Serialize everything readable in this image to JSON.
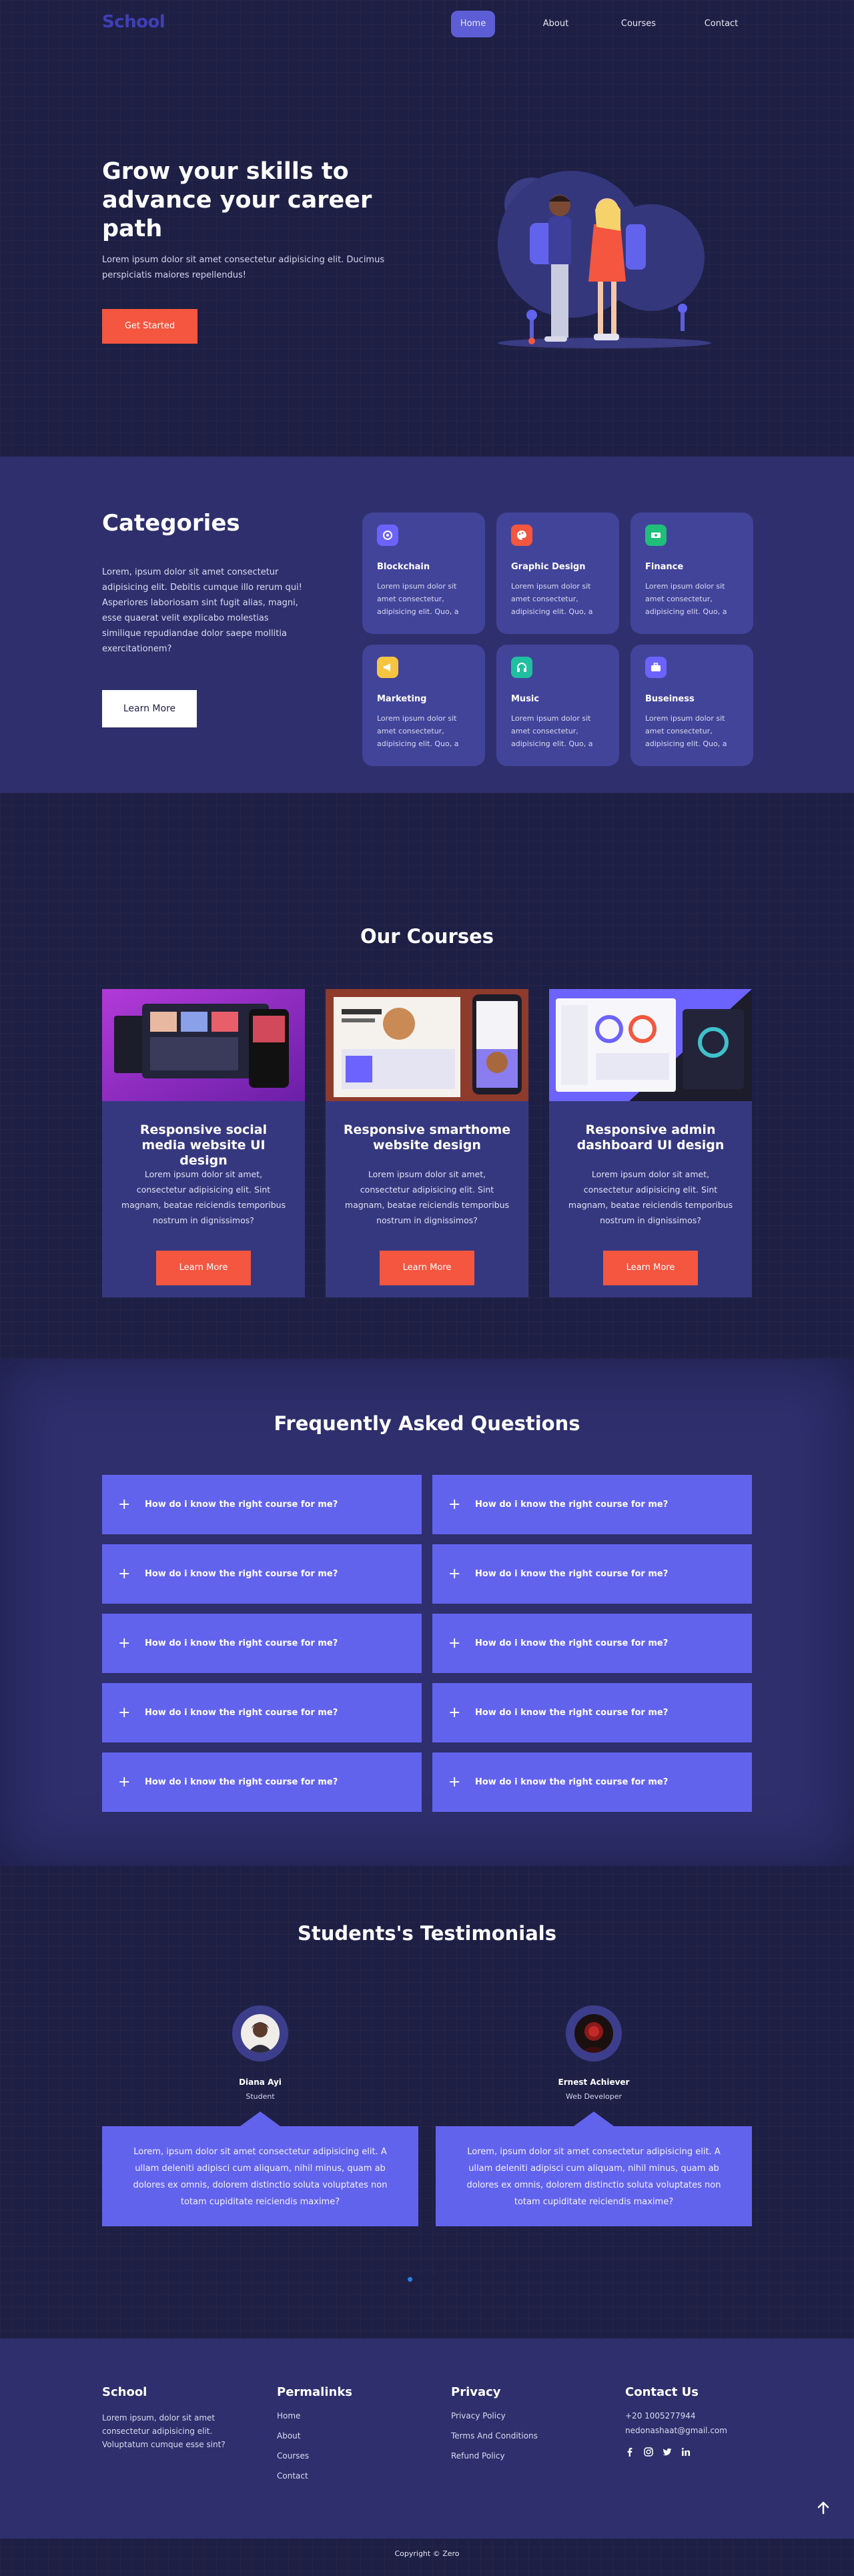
{
  "nav": {
    "logo": "School",
    "links": [
      {
        "label": "Home",
        "active": true
      },
      {
        "label": "About",
        "active": false
      },
      {
        "label": "Courses",
        "active": false
      },
      {
        "label": "Contact",
        "active": false
      }
    ]
  },
  "hero": {
    "title": "Grow your skills to advance your career path",
    "text": "Lorem ipsum dolor sit amet consectetur adipisicing elit. Ducimus perspiciatis maiores repellendus!",
    "button": "Get Started"
  },
  "categories": {
    "title": "Categories",
    "text": "Lorem, ipsum dolor sit amet consectetur adipisicing elit. Debitis cumque illo rerum qui! Asperiores laboriosam sint fugit alias, magni, esse quaerat velit explicabo molestias similique repudiandae dolor saepe mollitia exercitationem?",
    "button": "Learn More",
    "items": [
      {
        "name": "Blockchain",
        "icon": "blockchain-icon",
        "color": "#6c63ff",
        "desc": "Lorem ipsum dolor sit amet consectetur, adipisicing elit. Quo, a"
      },
      {
        "name": "Graphic Design",
        "icon": "palette-icon",
        "color": "#f4563f",
        "desc": "Lorem ipsum dolor sit amet consectetur, adipisicing elit. Quo, a"
      },
      {
        "name": "Finance",
        "icon": "money-icon",
        "color": "#1fbf7a",
        "desc": "Lorem ipsum dolor sit amet consectetur, adipisicing elit. Quo, a"
      },
      {
        "name": "Marketing",
        "icon": "megaphone-icon",
        "color": "#f5c542",
        "desc": "Lorem ipsum dolor sit amet consectetur, adipisicing elit. Quo, a"
      },
      {
        "name": "Music",
        "icon": "headphones-icon",
        "color": "#1fbf9f",
        "desc": "Lorem ipsum dolor sit amet consectetur, adipisicing elit. Quo, a"
      },
      {
        "name": "Buseiness",
        "icon": "briefcase-icon",
        "color": "#6c63ff",
        "desc": "Lorem ipsum dolor sit amet consectetur, adipisicing elit. Quo, a"
      }
    ]
  },
  "courses": {
    "title": "Our Courses",
    "items": [
      {
        "name": "Responsive social media website UI design",
        "desc": "Lorem ipsum dolor sit amet, consectetur adipisicing elit. Sint magnam, beatae reiciendis temporibus nostrum in dignissimos?",
        "button": "Learn More"
      },
      {
        "name": "Responsive smarthome website design",
        "desc": "Lorem ipsum dolor sit amet, consectetur adipisicing elit. Sint magnam, beatae reiciendis temporibus nostrum in dignissimos?",
        "button": "Learn More"
      },
      {
        "name": "Responsive admin dashboard UI design",
        "desc": "Lorem ipsum dolor sit amet, consectetur adipisicing elit. Sint magnam, beatae reiciendis temporibus nostrum in dignissimos?",
        "button": "Learn More"
      }
    ]
  },
  "faq": {
    "title": "Frequently Asked Questions",
    "items": [
      "How do i know the right course for me?",
      "How do i know the right course for me?",
      "How do i know the right course for me?",
      "How do i know the right course for me?",
      "How do i know the right course for me?",
      "How do i know the right course for me?",
      "How do i know the right course for me?",
      "How do i know the right course for me?",
      "How do i know the right course for me?",
      "How do i know the right course for me?"
    ]
  },
  "testimonials": {
    "title": "Students's Testimonials",
    "items": [
      {
        "name": "Diana Ayi",
        "role": "Student",
        "text": "Lorem, ipsum dolor sit amet consectetur adipisicing elit. A ullam deleniti adipisci cum aliquam, nihil minus, quam ab dolores ex omnis, dolorem distinctio soluta voluptates non totam cupiditate reiciendis maxime?"
      },
      {
        "name": "Ernest Achiever",
        "role": "Web Developer",
        "text": "Lorem, ipsum dolor sit amet consectetur adipisicing elit. A ullam deleniti adipisci cum aliquam, nihil minus, quam ab dolores ex omnis, dolorem distinctio soluta voluptates non totam cupiditate reiciendis maxime?"
      }
    ]
  },
  "footer": {
    "school": {
      "title": "School",
      "text": "Lorem ipsum, dolor sit amet consectetur adipisicing elit. Voluptatum cumque esse sint?"
    },
    "permalinks": {
      "title": "Permalinks",
      "links": [
        "Home",
        "About",
        "Courses",
        "Contact"
      ]
    },
    "privacy": {
      "title": "Privacy",
      "links": [
        "Privacy Policy",
        "Terms And Conditions",
        "Refund Policy"
      ]
    },
    "contact": {
      "title": "Contact Us",
      "phone": "+20 1005277944",
      "email": "nedonashaat@gmail.com",
      "socials": [
        "facebook-icon",
        "instagram-icon",
        "twitter-icon",
        "linkedin-icon"
      ]
    },
    "copyright": "Copyright © Zero"
  },
  "colors": {
    "accent": "#f4563f",
    "primary": "#6263ed",
    "background": "#1e1f44",
    "section": "#2e2f6c"
  }
}
